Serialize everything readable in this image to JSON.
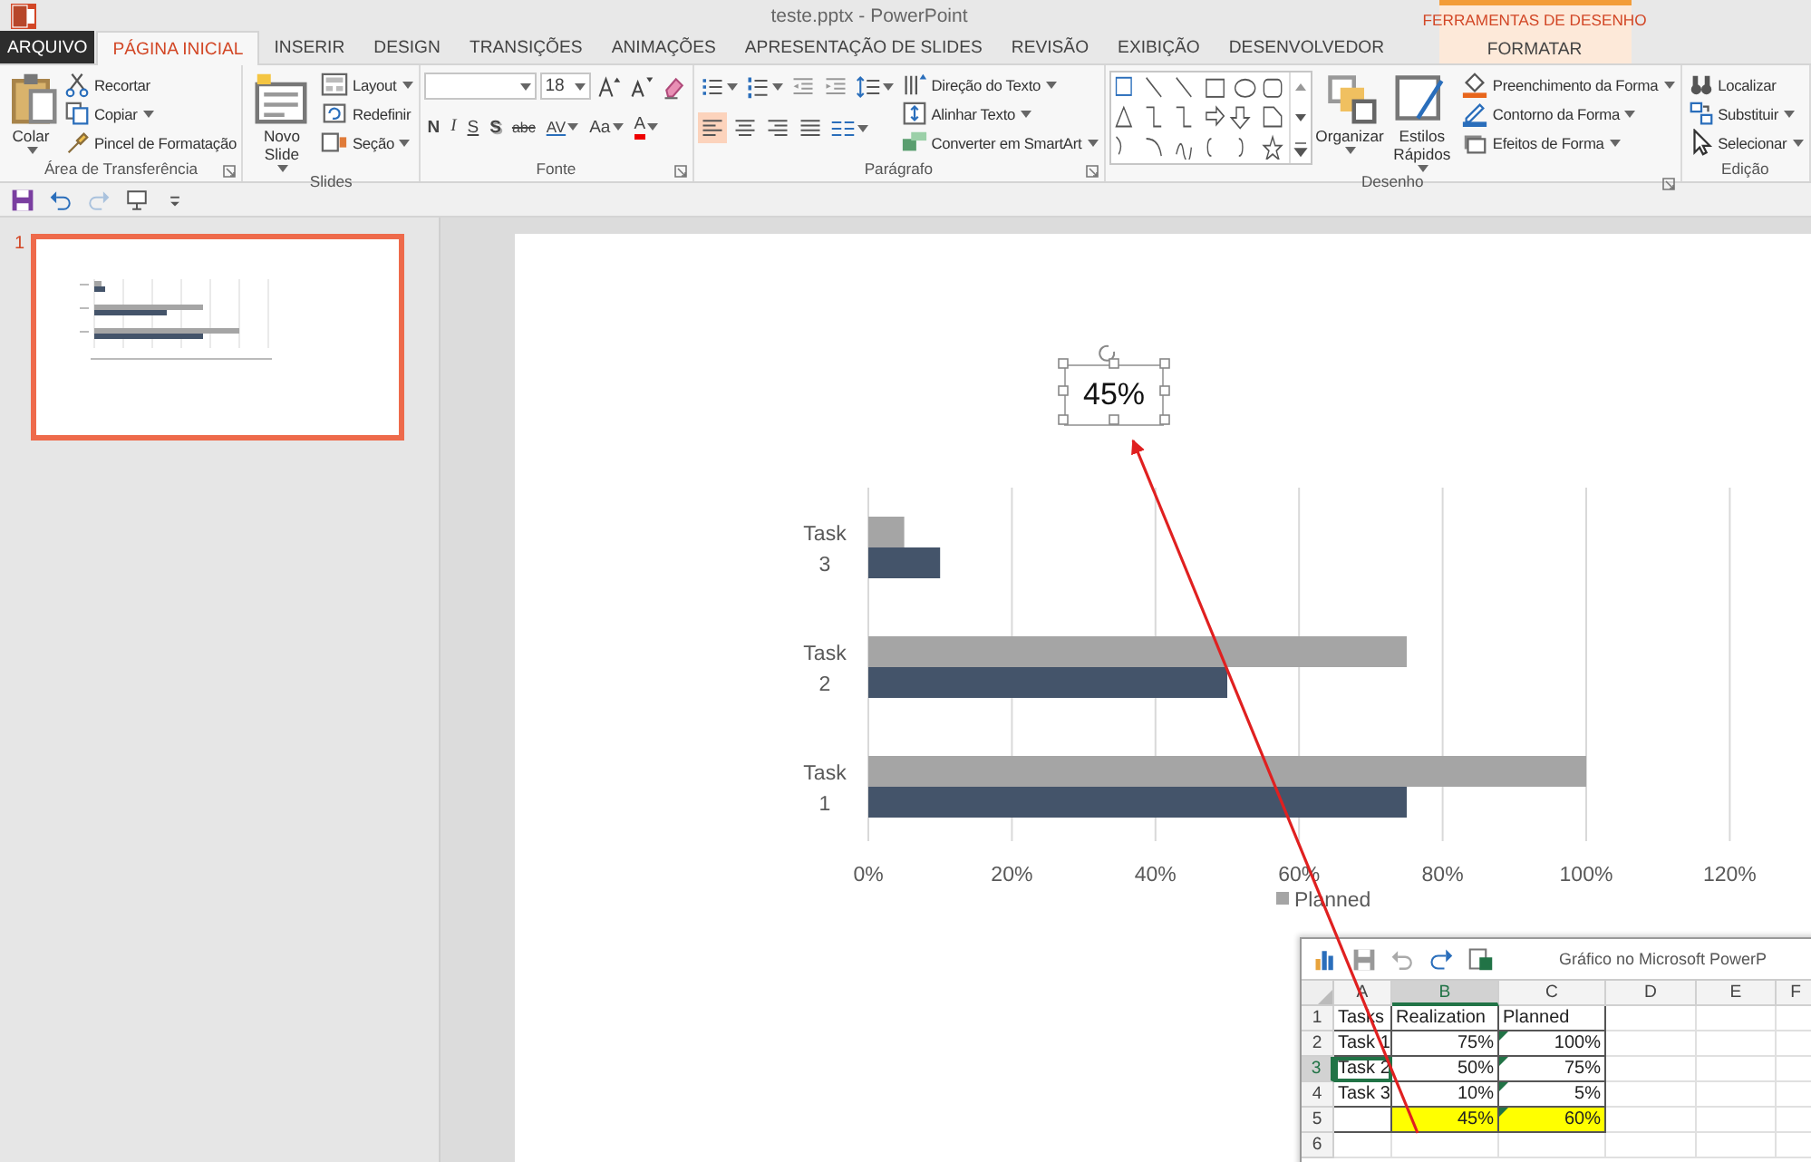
{
  "window": {
    "title": "teste.pptx - PowerPoint"
  },
  "contextual_tab_group": {
    "label": "FERRAMENTAS DE DESENHO"
  },
  "tabs": [
    {
      "label": "ARQUIVO",
      "kind": "file",
      "selected": false
    },
    {
      "label": "PÁGINA INICIAL",
      "kind": "normal",
      "selected": true
    },
    {
      "label": "INSERIR",
      "kind": "normal",
      "selected": false
    },
    {
      "label": "DESIGN",
      "kind": "normal",
      "selected": false
    },
    {
      "label": "TRANSIÇÕES",
      "kind": "normal",
      "selected": false
    },
    {
      "label": "ANIMAÇÕES",
      "kind": "normal",
      "selected": false
    },
    {
      "label": "APRESENTAÇÃO DE SLIDES",
      "kind": "normal",
      "selected": false
    },
    {
      "label": "REVISÃO",
      "kind": "normal",
      "selected": false
    },
    {
      "label": "EXIBIÇÃO",
      "kind": "normal",
      "selected": false
    },
    {
      "label": "DESENVOLVEDOR",
      "kind": "normal",
      "selected": false
    },
    {
      "label": "FORMATAR",
      "kind": "contextual",
      "selected": false
    }
  ],
  "ribbon": {
    "groups": [
      {
        "kind": "clipboard",
        "label": "Área de Transferência",
        "launcher": true,
        "large": [
          {
            "label": "Colar",
            "dropdown": true
          }
        ],
        "small": [
          {
            "label": "Recortar",
            "dropdown": false
          },
          {
            "label": "Copiar",
            "dropdown": true
          },
          {
            "label": "Pincel de Formatação",
            "dropdown": false
          }
        ]
      },
      {
        "kind": "slides",
        "label": "Slides",
        "launcher": false,
        "large": [
          {
            "label": "Novo Slide",
            "dropdown": true
          }
        ],
        "small": [
          {
            "label": "Layout",
            "dropdown": true
          },
          {
            "label": "Redefinir",
            "dropdown": false
          },
          {
            "label": "Seção",
            "dropdown": true
          }
        ]
      },
      {
        "kind": "font",
        "label": "Fonte",
        "launcher": true,
        "font_size": "18",
        "icon_buttons": [
          {
            "dropdown": false,
            "selected": false
          },
          {
            "dropdown": false,
            "selected": false
          },
          {
            "dropdown": false,
            "selected": false
          }
        ],
        "format_buttons": [
          {
            "label": "N",
            "dropdown": false
          },
          {
            "label": "I",
            "dropdown": false
          },
          {
            "label": "S",
            "dropdown": false
          },
          {
            "label": "S",
            "dropdown": false
          },
          {
            "label": "abc",
            "dropdown": false
          },
          {
            "label": "AV",
            "dropdown": true
          },
          {
            "label": "Aa",
            "dropdown": true
          },
          {
            "label": "A",
            "dropdown": true
          }
        ]
      },
      {
        "kind": "paragraph",
        "label": "Parágrafo",
        "launcher": true,
        "icon_buttons": [
          {
            "dropdown": true,
            "selected": false
          },
          {
            "dropdown": true,
            "selected": false
          },
          {
            "dropdown": false,
            "selected": false
          },
          {
            "dropdown": false,
            "selected": false
          },
          {
            "dropdown": true,
            "selected": false
          },
          {
            "dropdown": false,
            "selected": true
          },
          {
            "dropdown": false,
            "selected": false
          },
          {
            "dropdown": false,
            "selected": false
          },
          {
            "dropdown": false,
            "selected": false
          },
          {
            "dropdown": true,
            "selected": false
          }
        ],
        "small": [
          {
            "label": "Direção do Texto",
            "dropdown": true
          },
          {
            "label": "Alinhar Texto",
            "dropdown": true
          },
          {
            "label": "Converter em SmartArt",
            "dropdown": true
          }
        ]
      },
      {
        "kind": "drawing",
        "label": "Desenho",
        "launcher": true,
        "large": [
          {
            "label": "Organizar",
            "dropdown": true
          },
          {
            "label": "Estilos Rápidos",
            "dropdown": true
          }
        ],
        "small": [
          {
            "label": "Preenchimento da Forma",
            "dropdown": true
          },
          {
            "label": "Contorno da Forma",
            "dropdown": true
          },
          {
            "label": "Efeitos de Forma",
            "dropdown": true
          }
        ]
      },
      {
        "kind": "editing",
        "label": "Edição",
        "launcher": false,
        "small": [
          {
            "label": "Localizar",
            "dropdown": false
          },
          {
            "label": "Substituir",
            "dropdown": true
          },
          {
            "label": "Selecionar",
            "dropdown": true
          }
        ]
      }
    ]
  },
  "quick_access": [
    {
      "kind": "save",
      "disabled": false
    },
    {
      "kind": "undo",
      "disabled": false
    },
    {
      "kind": "redo",
      "disabled": true
    },
    {
      "kind": "present",
      "disabled": false
    }
  ],
  "thumbnails": [
    {
      "number": "1",
      "selected": true
    }
  ],
  "slide": {
    "text_box": {
      "text": "45%",
      "selected": true
    },
    "chart": {
      "chart_data": {
        "type": "bar",
        "orientation": "horizontal",
        "grid": true,
        "categories": [
          "Task 3",
          "Task 2",
          "Task 1"
        ],
        "series": [
          {
            "color": "#44546a",
            "values": [
              10,
              50,
              75
            ]
          },
          {
            "name": "Planned",
            "color": "#a5a5a5",
            "values": [
              5,
              75,
              100
            ]
          }
        ],
        "xlim": [
          0,
          120
        ],
        "xticks": [
          {
            "value": 0,
            "label": "0%"
          },
          {
            "value": 20,
            "label": "20%"
          },
          {
            "value": 40,
            "label": "40%"
          },
          {
            "value": 60,
            "label": "60%"
          },
          {
            "value": 80,
            "label": "80%"
          },
          {
            "value": 100,
            "label": "100%"
          },
          {
            "value": 120,
            "label": "120%"
          }
        ]
      }
    }
  },
  "chart_data_window": {
    "title": "Gráfico no Microsoft PowerP",
    "columns": [
      {
        "label": "A",
        "selected": false
      },
      {
        "label": "B",
        "selected": true
      },
      {
        "label": "C",
        "selected": false
      },
      {
        "label": "D",
        "selected": false
      },
      {
        "label": "E",
        "selected": false
      },
      {
        "label": "F",
        "selected": false
      }
    ],
    "rows": [
      {
        "label": "1",
        "selected": false,
        "cells": [
          {
            "kind": "text",
            "text": "Tasks",
            "active": false,
            "highlight": false,
            "flag": false
          },
          {
            "kind": "text",
            "text": "Realization",
            "active": false,
            "highlight": false,
            "flag": false
          },
          {
            "kind": "text",
            "text": "Planned",
            "active": false,
            "highlight": false,
            "flag": false
          }
        ]
      },
      {
        "label": "2",
        "selected": false,
        "cells": [
          {
            "kind": "text",
            "text": "Task 1",
            "active": false,
            "highlight": false,
            "flag": false
          },
          {
            "kind": "number",
            "text": "75%",
            "active": false,
            "highlight": false,
            "flag": false
          },
          {
            "kind": "number",
            "text": "100%",
            "active": false,
            "highlight": false,
            "flag": true
          }
        ]
      },
      {
        "label": "3",
        "selected": true,
        "cells": [
          {
            "kind": "text",
            "text": "Task 2",
            "active": true,
            "highlight": false,
            "flag": false
          },
          {
            "kind": "number",
            "text": "50%",
            "active": false,
            "highlight": false,
            "flag": false
          },
          {
            "kind": "number",
            "text": "75%",
            "active": false,
            "highlight": false,
            "flag": true
          }
        ]
      },
      {
        "label": "4",
        "selected": false,
        "cells": [
          {
            "kind": "text",
            "text": "Task 3",
            "active": false,
            "highlight": false,
            "flag": false
          },
          {
            "kind": "number",
            "text": "10%",
            "active": false,
            "highlight": false,
            "flag": false
          },
          {
            "kind": "number",
            "text": "5%",
            "active": false,
            "highlight": false,
            "flag": true
          }
        ]
      },
      {
        "label": "5",
        "selected": false,
        "cells": [
          {
            "kind": "empty",
            "active": false,
            "highlight": false,
            "flag": false
          },
          {
            "kind": "number",
            "text": "45%",
            "active": false,
            "highlight": true,
            "flag": false
          },
          {
            "kind": "number",
            "text": "60%",
            "active": false,
            "highlight": true,
            "flag": true
          }
        ]
      },
      {
        "label": "6",
        "selected": false,
        "cells": []
      }
    ]
  }
}
